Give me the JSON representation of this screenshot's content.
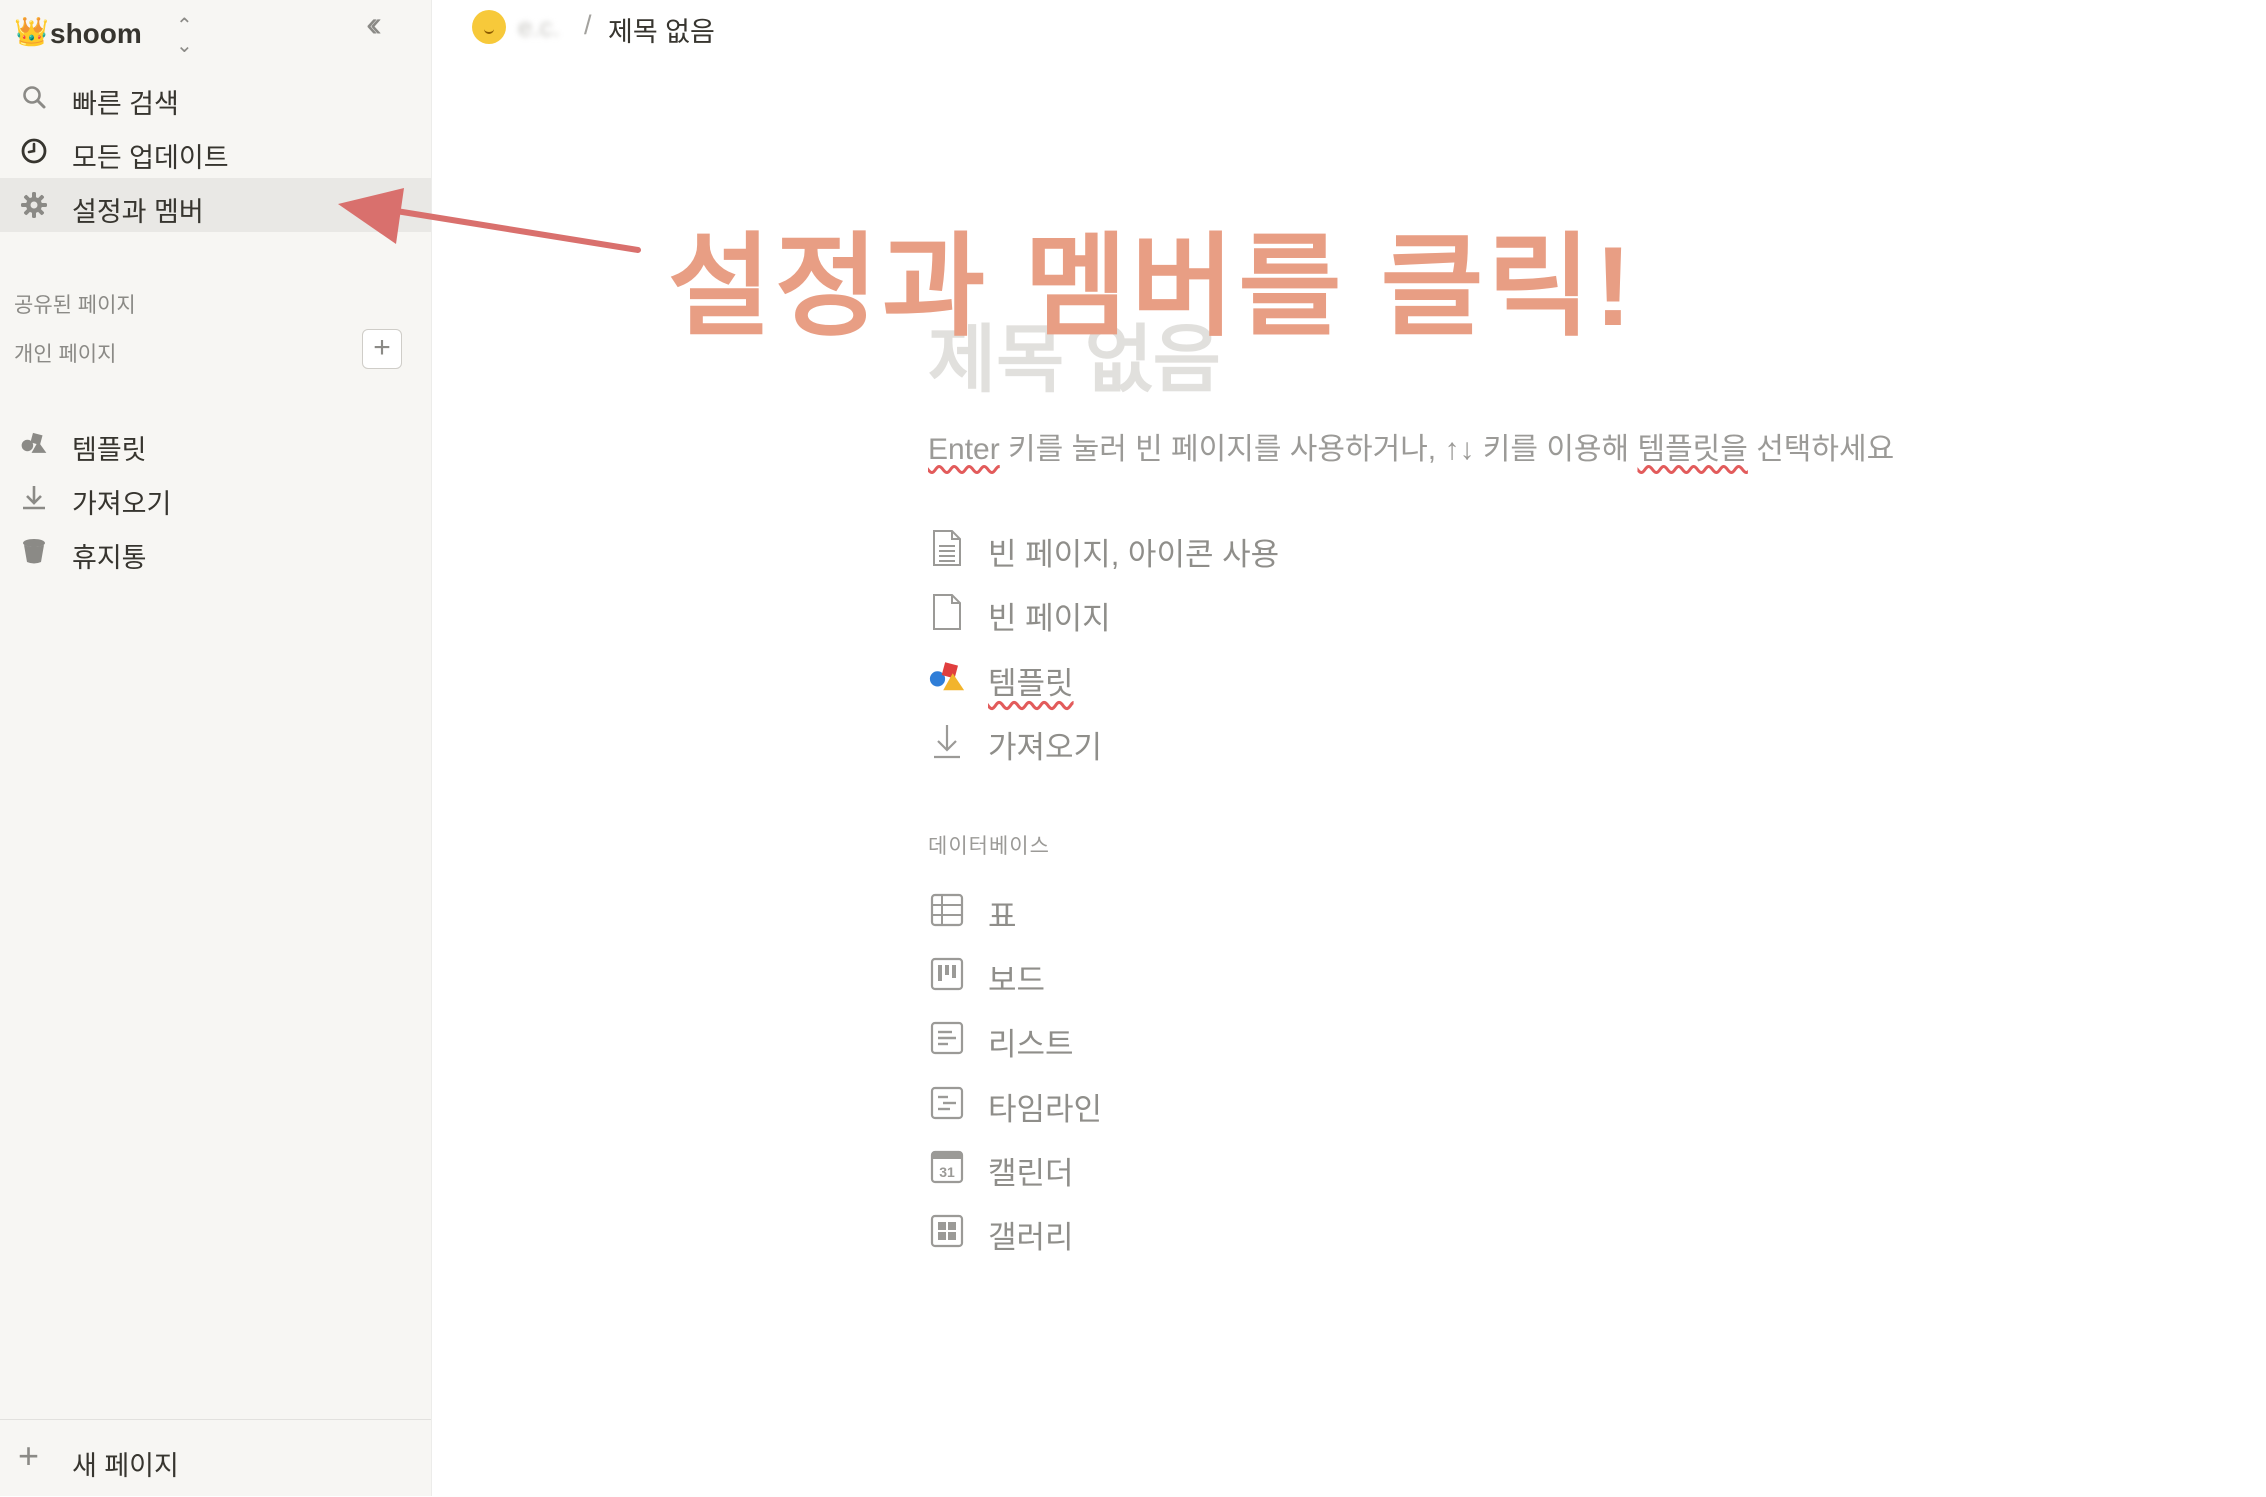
{
  "sidebar": {
    "workspace": {
      "icon": "crown-icon",
      "name": "shoom"
    },
    "nav": [
      {
        "label": "빠른 검색",
        "icon": "search-icon"
      },
      {
        "label": "모든 업데이트",
        "icon": "clock-icon"
      },
      {
        "label": "설정과 멤버",
        "icon": "gear-icon",
        "active": true
      }
    ],
    "sections": {
      "shared": "공유된 페이지",
      "private": "개인 페이지"
    },
    "tools": [
      {
        "label": "템플릿",
        "icon": "template-shapes-icon"
      },
      {
        "label": "가져오기",
        "icon": "download-icon"
      },
      {
        "label": "휴지통",
        "icon": "trash-icon"
      }
    ],
    "new_page": "새 페이지"
  },
  "topbar": {
    "crumb_emoji": "slightly-smiling-face-icon",
    "crumb_parent": "e.c.",
    "separator": "/",
    "crumb_title": "제목 없음"
  },
  "page": {
    "title_placeholder": "제목 없음",
    "hint_prefix": "Enter",
    "hint_middle": " 키를 눌러 빈 페이지를 사용하거나, ↑↓ 키를 이용해 ",
    "hint_word": "템플릿을",
    "hint_suffix": " 선택하세요",
    "options": [
      {
        "label": "빈 페이지, 아이콘 사용",
        "icon": "page-lines-icon"
      },
      {
        "label": "빈 페이지",
        "icon": "blank-page-icon"
      },
      {
        "label": "템플릿",
        "icon": "template-shapes-icon"
      },
      {
        "label": "가져오기",
        "icon": "download-icon"
      }
    ],
    "database_label": "데이터베이스",
    "databases": [
      {
        "label": "표",
        "icon": "table-icon"
      },
      {
        "label": "보드",
        "icon": "board-icon"
      },
      {
        "label": "리스트",
        "icon": "list-icon"
      },
      {
        "label": "타임라인",
        "icon": "timeline-icon"
      },
      {
        "label": "캘린더",
        "icon": "calendar-icon",
        "badge": "31"
      },
      {
        "label": "갤러리",
        "icon": "gallery-icon"
      }
    ]
  },
  "annotation": {
    "text": "설정과 멤버를 클릭!",
    "color": "#e89e84",
    "arrow_color": "#d9706d"
  }
}
